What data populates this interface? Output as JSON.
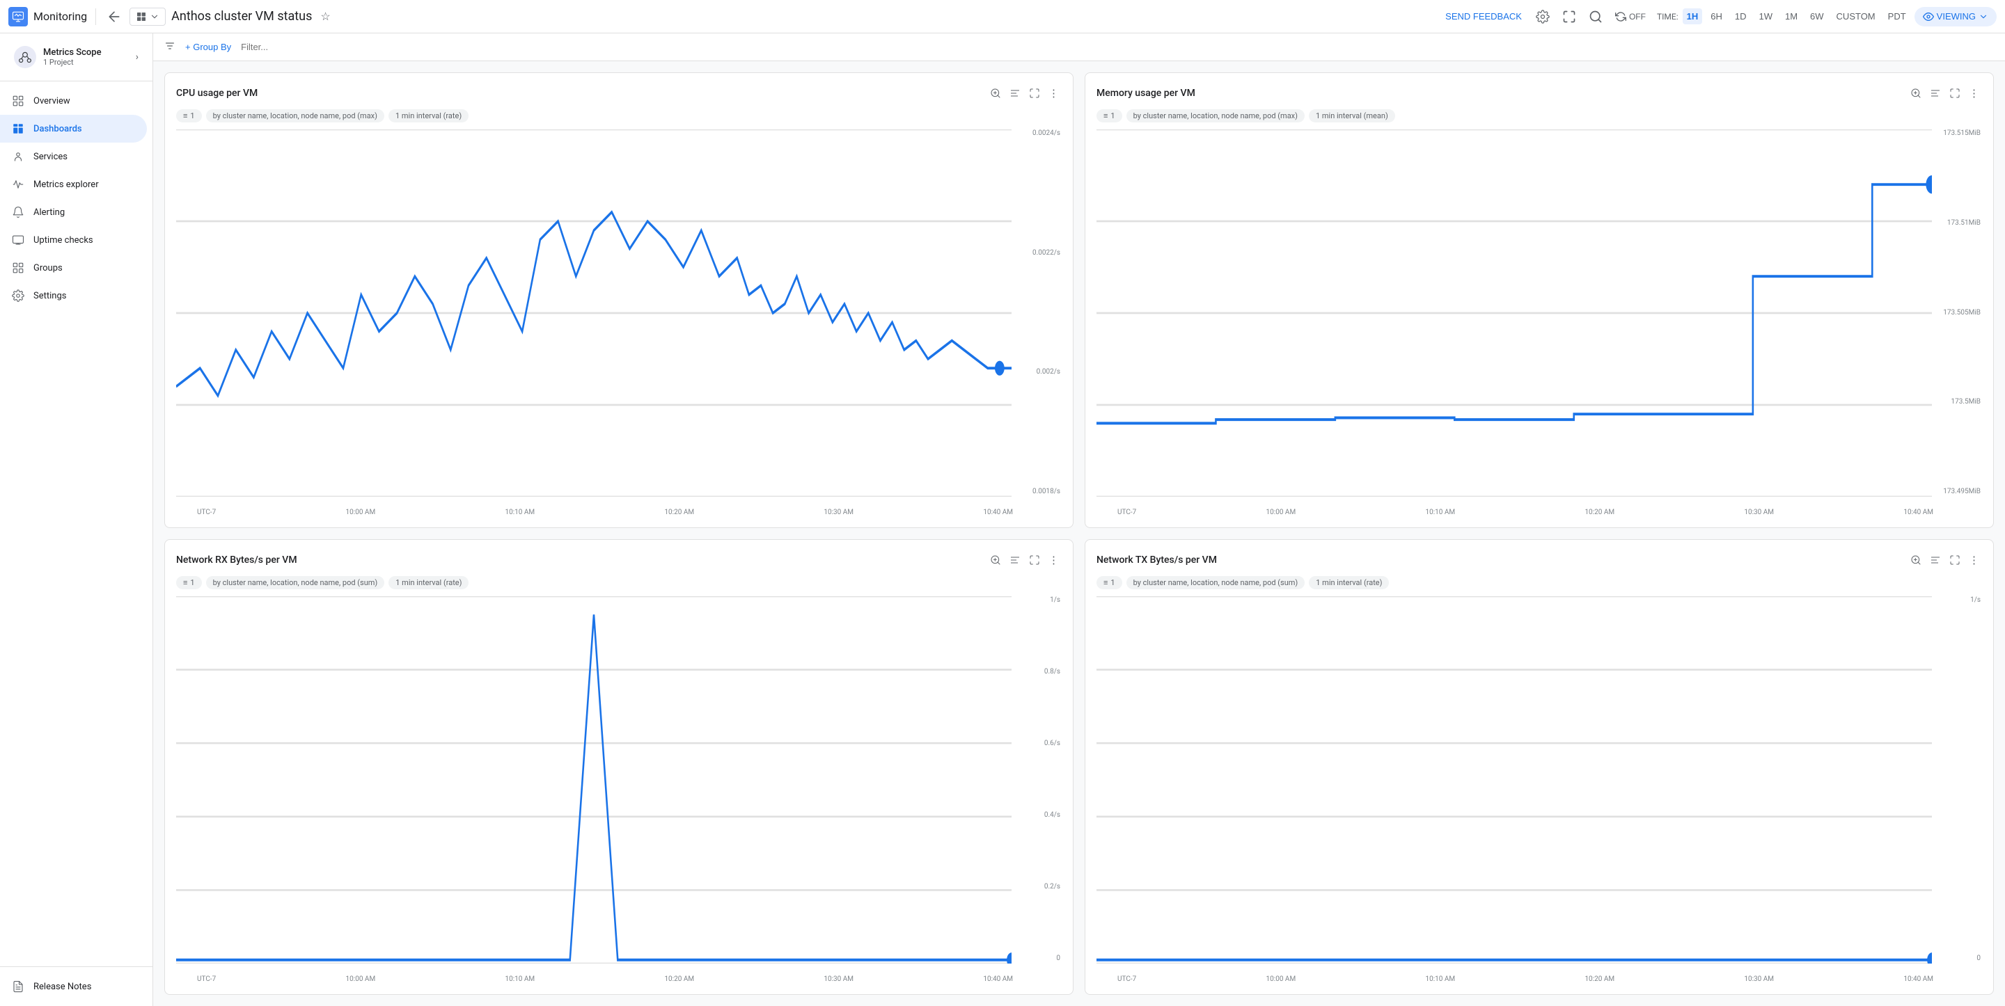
{
  "app": {
    "name": "Monitoring",
    "icon": "M"
  },
  "topbar": {
    "back_title": "Back",
    "breadcrumb_icon": "dashboard",
    "page_title": "Anthos cluster VM status",
    "feedback_label": "SEND FEEDBACK",
    "time_label": "TIME:",
    "time_options": [
      "1H",
      "6H",
      "1D",
      "1W",
      "1M",
      "6W",
      "CUSTOM",
      "PDT"
    ],
    "active_time": "1H",
    "refresh_label": "OFF",
    "viewing_label": "VIEWING"
  },
  "toolbar": {
    "group_by_label": "+ Group By",
    "filter_placeholder": "Filter..."
  },
  "sidebar": {
    "scope_name": "Metrics Scope",
    "scope_sub": "1 Project",
    "nav_items": [
      {
        "id": "overview",
        "label": "Overview",
        "icon": "📊"
      },
      {
        "id": "dashboards",
        "label": "Dashboards",
        "icon": "⊞",
        "active": true
      },
      {
        "id": "services",
        "label": "Services",
        "icon": "👤"
      },
      {
        "id": "metrics-explorer",
        "label": "Metrics explorer",
        "icon": "📈"
      },
      {
        "id": "alerting",
        "label": "Alerting",
        "icon": "🔔"
      },
      {
        "id": "uptime-checks",
        "label": "Uptime checks",
        "icon": "🖥"
      },
      {
        "id": "groups",
        "label": "Groups",
        "icon": "⊞"
      },
      {
        "id": "settings",
        "label": "Settings",
        "icon": "⚙"
      }
    ],
    "bottom_items": [
      {
        "id": "release-notes",
        "label": "Release Notes",
        "icon": "📄"
      }
    ]
  },
  "charts": [
    {
      "id": "cpu-usage",
      "title": "CPU usage per VM",
      "tags": [
        {
          "filter": "1",
          "label": "by cluster name, location, node name, pod (max)"
        },
        {
          "label": "1 min interval (rate)"
        }
      ],
      "y_labels": [
        "0.0024/s",
        "0.0022/s",
        "0.002/s",
        "0.0018/s"
      ],
      "x_labels": [
        "UTC-7",
        "10:00 AM",
        "10:10 AM",
        "10:20 AM",
        "10:30 AM",
        "10:40 AM"
      ],
      "type": "line_wavy"
    },
    {
      "id": "memory-usage",
      "title": "Memory usage per VM",
      "tags": [
        {
          "filter": "1",
          "label": "by cluster name, location, node name, pod (max)"
        },
        {
          "label": "1 min interval (mean)"
        }
      ],
      "y_labels": [
        "173.515MiB",
        "173.51MiB",
        "173.505MiB",
        "173.5MiB",
        "173.495MiB"
      ],
      "x_labels": [
        "UTC-7",
        "10:00 AM",
        "10:10 AM",
        "10:20 AM",
        "10:30 AM",
        "10:40 AM"
      ],
      "type": "line_step"
    },
    {
      "id": "network-rx",
      "title": "Network RX Bytes/s per VM",
      "tags": [
        {
          "filter": "1",
          "label": "by cluster name, location, node name, pod (sum)"
        },
        {
          "label": "1 min interval (rate)"
        }
      ],
      "y_labels": [
        "1/s",
        "0.8/s",
        "0.6/s",
        "0.4/s",
        "0.2/s",
        "0"
      ],
      "x_labels": [
        "UTC-7",
        "10:00 AM",
        "10:10 AM",
        "10:20 AM",
        "10:30 AM",
        "10:40 AM"
      ],
      "type": "line_spike"
    },
    {
      "id": "network-tx",
      "title": "Network TX Bytes/s per VM",
      "tags": [
        {
          "filter": "1",
          "label": "by cluster name, location, node name, pod (sum)"
        },
        {
          "label": "1 min interval (rate)"
        }
      ],
      "y_labels": [
        "1/s",
        "",
        "",
        "",
        "",
        "0"
      ],
      "x_labels": [
        "UTC-7",
        "10:00 AM",
        "10:10 AM",
        "10:20 AM",
        "10:30 AM",
        "10:40 AM"
      ],
      "type": "line_flat"
    }
  ]
}
